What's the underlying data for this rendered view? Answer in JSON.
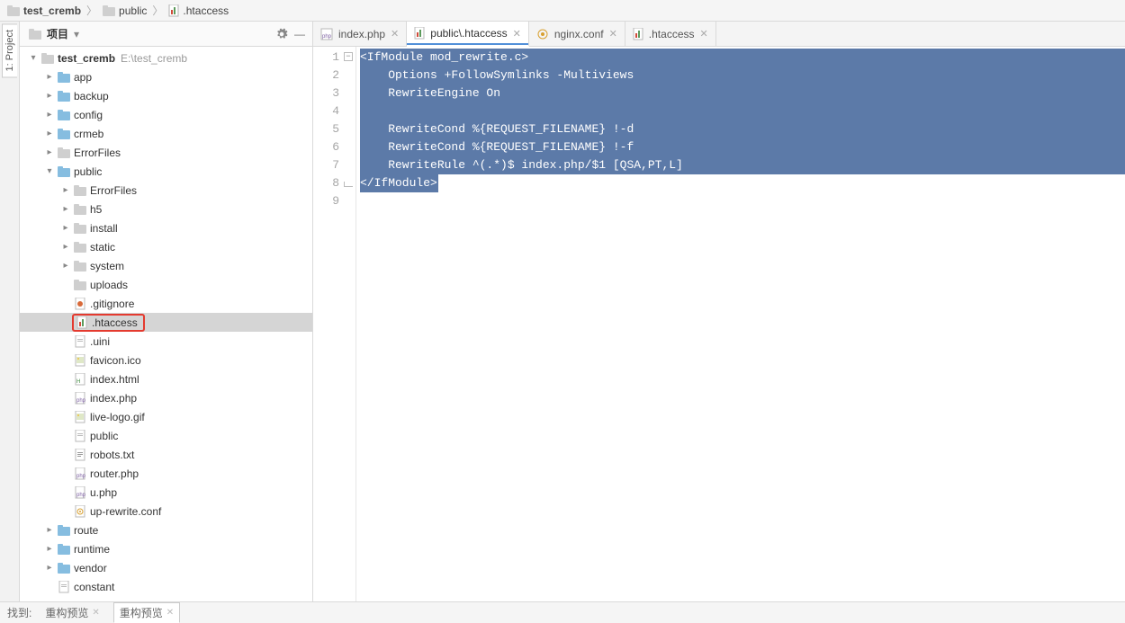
{
  "breadcrumb": {
    "root": "test_cremb",
    "mid": "public",
    "file": ".htaccess"
  },
  "left_tool_tab": "1: Project",
  "project_panel": {
    "title": "项目",
    "gear_tooltip": "settings",
    "collapse_tooltip": "collapse"
  },
  "tree": {
    "root_label": "test_cremb",
    "root_path": "E:\\test_cremb",
    "items": [
      {
        "label": "app",
        "type": "folder-blue",
        "depth": 1,
        "expand": "right"
      },
      {
        "label": "backup",
        "type": "folder-blue",
        "depth": 1,
        "expand": "right"
      },
      {
        "label": "config",
        "type": "folder-blue",
        "depth": 1,
        "expand": "right"
      },
      {
        "label": "crmeb",
        "type": "folder-blue",
        "depth": 1,
        "expand": "right"
      },
      {
        "label": "ErrorFiles",
        "type": "folder",
        "depth": 1,
        "expand": "right"
      },
      {
        "label": "public",
        "type": "folder-blue",
        "depth": 1,
        "expand": "down"
      },
      {
        "label": "ErrorFiles",
        "type": "folder",
        "depth": 2,
        "expand": "right"
      },
      {
        "label": "h5",
        "type": "folder",
        "depth": 2,
        "expand": "right"
      },
      {
        "label": "install",
        "type": "folder",
        "depth": 2,
        "expand": "right"
      },
      {
        "label": "static",
        "type": "folder",
        "depth": 2,
        "expand": "right"
      },
      {
        "label": "system",
        "type": "folder",
        "depth": 2,
        "expand": "right"
      },
      {
        "label": "uploads",
        "type": "folder",
        "depth": 2,
        "expand": ""
      },
      {
        "label": ".gitignore",
        "type": "file-git",
        "depth": 2,
        "expand": ""
      },
      {
        "label": ".htaccess",
        "type": "file-ht",
        "depth": 2,
        "expand": "",
        "selected": true,
        "highlight": true
      },
      {
        "label": ".uini",
        "type": "file",
        "depth": 2,
        "expand": ""
      },
      {
        "label": "favicon.ico",
        "type": "file-img",
        "depth": 2,
        "expand": ""
      },
      {
        "label": "index.html",
        "type": "file-html",
        "depth": 2,
        "expand": ""
      },
      {
        "label": "index.php",
        "type": "file-php",
        "depth": 2,
        "expand": ""
      },
      {
        "label": "live-logo.gif",
        "type": "file-img",
        "depth": 2,
        "expand": ""
      },
      {
        "label": "public",
        "type": "file",
        "depth": 2,
        "expand": ""
      },
      {
        "label": "robots.txt",
        "type": "file-txt",
        "depth": 2,
        "expand": ""
      },
      {
        "label": "router.php",
        "type": "file-php",
        "depth": 2,
        "expand": ""
      },
      {
        "label": "u.php",
        "type": "file-php",
        "depth": 2,
        "expand": ""
      },
      {
        "label": "up-rewrite.conf",
        "type": "file-conf",
        "depth": 2,
        "expand": ""
      },
      {
        "label": "route",
        "type": "folder-blue",
        "depth": 1,
        "expand": "right"
      },
      {
        "label": "runtime",
        "type": "folder-blue",
        "depth": 1,
        "expand": "right"
      },
      {
        "label": "vendor",
        "type": "folder-blue",
        "depth": 1,
        "expand": "right"
      },
      {
        "label": "constant",
        "type": "file",
        "depth": 1,
        "expand": ""
      }
    ]
  },
  "tabs": [
    {
      "label": "index.php",
      "icon": "php",
      "active": false
    },
    {
      "label": "public\\.htaccess",
      "icon": "ht",
      "active": true
    },
    {
      "label": "nginx.conf",
      "icon": "conf",
      "active": false
    },
    {
      "label": ".htaccess",
      "icon": "ht",
      "active": false
    }
  ],
  "code_lines": [
    "<IfModule mod_rewrite.c>",
    "    Options +FollowSymlinks -Multiviews",
    "    RewriteEngine On",
    "",
    "    RewriteCond %{REQUEST_FILENAME} !-d",
    "    RewriteCond %{REQUEST_FILENAME} !-f",
    "    RewriteRule ^(.*)$ index.php/$1 [QSA,PT,L]",
    "</IfModule>"
  ],
  "gutter_count": 9,
  "status": {
    "found_label": "找到:",
    "preview1": "重构预览",
    "preview2": "重构预览"
  }
}
